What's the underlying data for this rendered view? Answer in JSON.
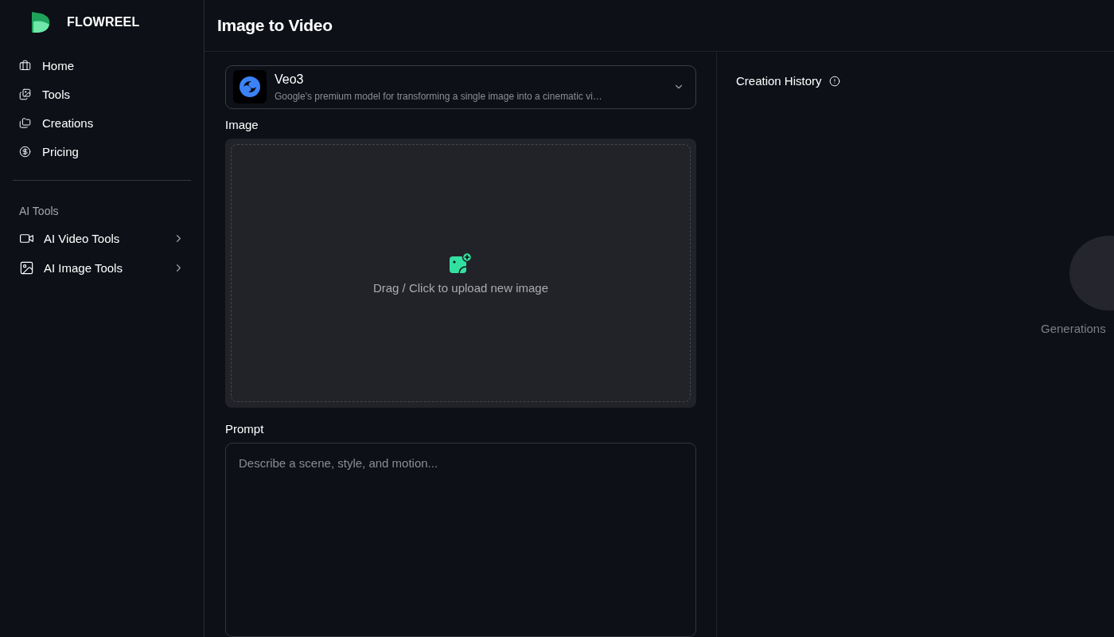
{
  "sidebar": {
    "brand": "FLOWREEL",
    "nav": [
      {
        "label": "Home"
      },
      {
        "label": "Tools"
      },
      {
        "label": "Creations"
      },
      {
        "label": "Pricing"
      }
    ],
    "section_title": "AI Tools",
    "groups": [
      {
        "label": "AI Video Tools",
        "expanded": false
      },
      {
        "label": "AI Image Tools",
        "expanded": false
      }
    ]
  },
  "header": {
    "title": "Image to Video"
  },
  "model": {
    "name": "Veo3",
    "description": "Google's premium model for transforming a single image into a cinematic vi…"
  },
  "image": {
    "label": "Image",
    "upload_text": "Drag / Click to upload new image"
  },
  "prompt": {
    "label": "Prompt",
    "placeholder": "Describe a scene, style, and motion..."
  },
  "history": {
    "title": "Creation History",
    "empty_text": "Generations"
  }
}
